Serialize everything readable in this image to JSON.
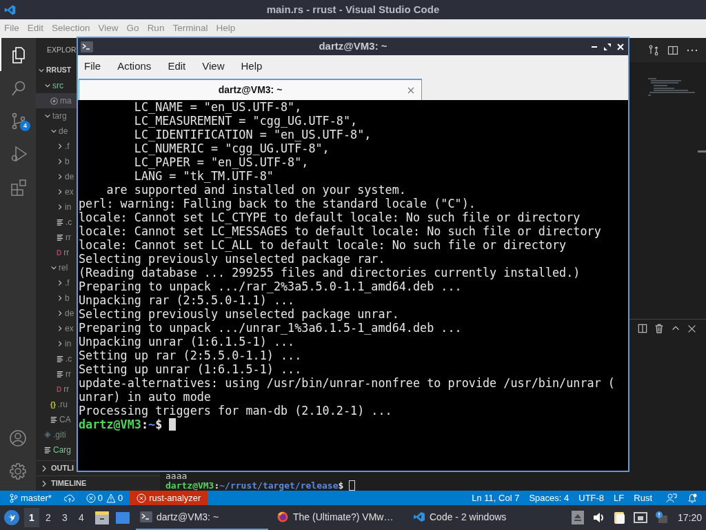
{
  "vscode": {
    "title": "main.rs - rrust - Visual Studio Code",
    "menu": [
      "File",
      "Edit",
      "Selection",
      "View",
      "Go",
      "Run",
      "Terminal",
      "Help"
    ],
    "activity": [
      {
        "kind": "explorer",
        "selected": true
      },
      {
        "kind": "search",
        "selected": false
      },
      {
        "kind": "scm",
        "selected": false,
        "badge": "4"
      },
      {
        "kind": "debug",
        "selected": false
      },
      {
        "kind": "extensions",
        "selected": false
      }
    ],
    "activity_bottom": [
      {
        "kind": "account"
      },
      {
        "kind": "settings"
      }
    ],
    "sidebar": {
      "title": "EXPLOR",
      "tree": [
        {
          "label": "RRUST",
          "kind": "root",
          "expanded": true,
          "selected": false,
          "children": [
            {
              "label": "src",
              "kind": "folder",
              "expanded": true,
              "selected": false,
              "color": "#73c991",
              "children": [
                {
                  "label": "ma",
                  "kind": "rust",
                  "selected": true,
                  "color": "#8c8c8c"
                }
              ]
            },
            {
              "label": "targ",
              "kind": "folder",
              "expanded": true,
              "selected": false,
              "color": "#8c8c8c",
              "children": [
                {
                  "label": "de",
                  "kind": "folder",
                  "expanded": true,
                  "selected": false,
                  "color": "#8c8c8c",
                  "children": [
                    {
                      "label": ".f",
                      "kind": "folder",
                      "expanded": false,
                      "selected": false,
                      "color": "#8c8c8c"
                    },
                    {
                      "label": "b",
                      "kind": "folder",
                      "expanded": false,
                      "selected": false,
                      "color": "#8c8c8c"
                    },
                    {
                      "label": "de",
                      "kind": "folder",
                      "expanded": false,
                      "selected": false,
                      "color": "#8c8c8c"
                    },
                    {
                      "label": "ex",
                      "kind": "folder",
                      "expanded": false,
                      "selected": false,
                      "color": "#8c8c8c"
                    },
                    {
                      "label": "in",
                      "kind": "folder",
                      "expanded": false,
                      "selected": false,
                      "color": "#8c8c8c"
                    },
                    {
                      "label": ".c",
                      "kind": "text",
                      "selected": false,
                      "color": "#8c8c8c"
                    },
                    {
                      "label": "rr",
                      "kind": "text",
                      "selected": false,
                      "color": "#8c8c8c"
                    },
                    {
                      "label": "rr",
                      "kind": "glyph",
                      "glyph": "D",
                      "selected": false,
                      "color": "#8c8c8c"
                    }
                  ]
                },
                {
                  "label": "rel",
                  "kind": "folder",
                  "expanded": true,
                  "selected": false,
                  "color": "#8c8c8c",
                  "children": [
                    {
                      "label": ".f",
                      "kind": "folder",
                      "expanded": false,
                      "selected": false,
                      "color": "#8c8c8c"
                    },
                    {
                      "label": "b",
                      "kind": "folder",
                      "expanded": false,
                      "selected": false,
                      "color": "#8c8c8c"
                    },
                    {
                      "label": "de",
                      "kind": "folder",
                      "expanded": false,
                      "selected": false,
                      "color": "#8c8c8c"
                    },
                    {
                      "label": "ex",
                      "kind": "folder",
                      "expanded": false,
                      "selected": false,
                      "color": "#8c8c8c"
                    },
                    {
                      "label": "in",
                      "kind": "folder",
                      "expanded": false,
                      "selected": false,
                      "color": "#8c8c8c"
                    },
                    {
                      "label": ".c",
                      "kind": "text",
                      "selected": false,
                      "color": "#8c8c8c"
                    },
                    {
                      "label": "rr",
                      "kind": "text",
                      "selected": false,
                      "color": "#8c8c8c"
                    },
                    {
                      "label": "rr",
                      "kind": "glyph",
                      "glyph": "D",
                      "selected": false,
                      "color": "#8c8c8c"
                    }
                  ]
                },
                {
                  "label": ".ru",
                  "kind": "glyph",
                  "glyph": "{}",
                  "selected": false,
                  "color": "#8c8c8c"
                },
                {
                  "label": "CA",
                  "kind": "text",
                  "selected": false,
                  "color": "#8c8c8c"
                }
              ]
            },
            {
              "label": ".giti",
              "kind": "git",
              "selected": false,
              "color": "#6f8a78"
            },
            {
              "label": "Carg",
              "kind": "text",
              "selected": false,
              "color": "#73c991"
            }
          ]
        }
      ],
      "sections": [
        {
          "label": "OUTLI",
          "expanded": false
        },
        {
          "label": "TIMELINE",
          "expanded": false
        }
      ]
    },
    "panel_lines": [
      {
        "kind": "plain",
        "text": "aaaa"
      },
      {
        "kind": "prompt",
        "user": "dartz@VM3",
        "sep": ":",
        "path": "~/rrust/target/release",
        "end": "$ "
      }
    ],
    "status_left": [
      {
        "kind": "branch",
        "text": "master*"
      },
      {
        "kind": "sync"
      },
      {
        "kind": "problems",
        "errors": "0",
        "warnings": "0"
      },
      {
        "kind": "error",
        "text": "rust-analyzer"
      }
    ],
    "status_right": [
      "Ln 11, Col 7",
      "Spaces: 4",
      "UTF-8",
      "LF",
      "Rust"
    ]
  },
  "terminal": {
    "title": "dartz@VM3: ~",
    "menu": [
      "File",
      "Actions",
      "Edit",
      "View",
      "Help"
    ],
    "tab": "dartz@VM3: ~",
    "lines": [
      "        LC_NAME = \"en_US.UTF-8\",",
      "        LC_MEASUREMENT = \"cgg_UG.UTF-8\",",
      "        LC_IDENTIFICATION = \"en_US.UTF-8\",",
      "        LC_NUMERIC = \"cgg_UG.UTF-8\",",
      "        LC_PAPER = \"en_US.UTF-8\",",
      "        LANG = \"tk_TM.UTF-8\"",
      "    are supported and installed on your system.",
      "perl: warning: Falling back to the standard locale (\"C\").",
      "locale: Cannot set LC_CTYPE to default locale: No such file or directory",
      "locale: Cannot set LC_MESSAGES to default locale: No such file or directory",
      "locale: Cannot set LC_ALL to default locale: No such file or directory",
      "Selecting previously unselected package rar.",
      "(Reading database ... 299255 files and directories currently installed.)",
      "Preparing to unpack .../rar_2%3a5.5.0-1.1_amd64.deb ...",
      "Unpacking rar (2:5.5.0-1.1) ...",
      "Selecting previously unselected package unrar.",
      "Preparing to unpack .../unrar_1%3a6.1.5-1_amd64.deb ...",
      "Unpacking unrar (1:6.1.5-1) ...",
      "Setting up rar (2:5.5.0-1.1) ...",
      "Setting up unrar (1:6.1.5-1) ...",
      "update-alternatives: using /usr/bin/unrar-nonfree to provide /usr/bin/unrar (",
      "unrar) in auto mode",
      "Processing triggers for man-db (2.10.2-1) ..."
    ],
    "prompt": {
      "user": "dartz@VM3",
      "sep": ":",
      "path": "~",
      "end": "$ "
    }
  },
  "taskbar": {
    "workspaces": [
      {
        "label": "1",
        "selected": true
      },
      {
        "label": "2",
        "selected": false
      },
      {
        "label": "3",
        "selected": false
      },
      {
        "label": "4",
        "selected": false
      }
    ],
    "launchers": [
      {
        "kind": "files"
      },
      {
        "kind": "desktop"
      }
    ],
    "tasks": [
      {
        "kind": "terminal",
        "label": "dartz@VM3: ~",
        "selected": true
      },
      {
        "kind": "firefox",
        "label": "The (Ultimate?) VMw…",
        "selected": false
      },
      {
        "kind": "vscode",
        "label": "Code - 2 windows",
        "selected": false
      }
    ],
    "tray": [
      {
        "kind": "eject"
      },
      {
        "kind": "volume"
      },
      {
        "kind": "clipboard"
      },
      {
        "kind": "network"
      },
      {
        "kind": "notify"
      }
    ],
    "clock": "17:20"
  }
}
